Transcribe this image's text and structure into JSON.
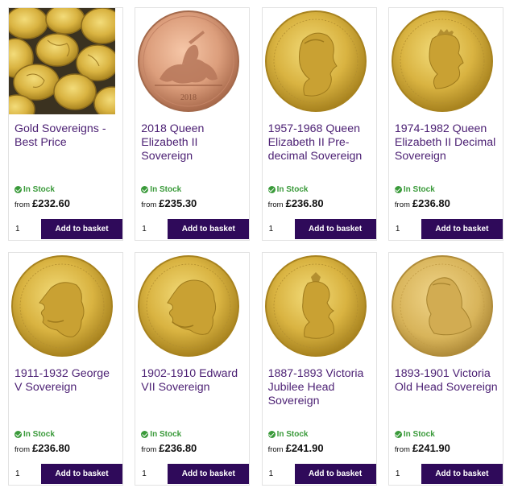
{
  "products": [
    {
      "title": "Gold Sovereigns - Best Price",
      "image_icon": "sovereign-pile-image",
      "stock": "In Stock",
      "from_label": "from",
      "price": "£232.60",
      "qty": "1",
      "button": "Add to basket"
    },
    {
      "title": "2018 Queen Elizabeth II Sovereign",
      "image_icon": "sovereign-2018-reverse-image",
      "coin_year": "2018",
      "stock": "In Stock",
      "from_label": "from",
      "price": "£235.30",
      "qty": "1",
      "button": "Add to basket"
    },
    {
      "title": "1957-1968 Queen Elizabeth II Pre-decimal Sovereign",
      "image_icon": "sovereign-elizabeth-young-image",
      "stock": "In Stock",
      "from_label": "from",
      "price": "£236.80",
      "qty": "1",
      "button": "Add to basket"
    },
    {
      "title": "1974-1982 Queen Elizabeth II Decimal Sovereign",
      "image_icon": "sovereign-elizabeth-decimal-image",
      "stock": "In Stock",
      "from_label": "from",
      "price": "£236.80",
      "qty": "1",
      "button": "Add to basket"
    },
    {
      "title": "1911-1932 George V Sovereign",
      "image_icon": "sovereign-george-v-image",
      "stock": "In Stock",
      "from_label": "from",
      "price": "£236.80",
      "qty": "1",
      "button": "Add to basket"
    },
    {
      "title": "1902-1910 Edward VII Sovereign",
      "image_icon": "sovereign-edward-vii-image",
      "stock": "In Stock",
      "from_label": "from",
      "price": "£236.80",
      "qty": "1",
      "button": "Add to basket"
    },
    {
      "title": "1887-1893 Victoria Jubilee Head Sovereign",
      "image_icon": "sovereign-victoria-jubilee-image",
      "stock": "In Stock",
      "from_label": "from",
      "price": "£241.90",
      "qty": "1",
      "button": "Add to basket"
    },
    {
      "title": "1893-1901 Victoria Old Head Sovereign",
      "image_icon": "sovereign-victoria-old-head-image",
      "stock": "In Stock",
      "from_label": "from",
      "price": "£241.90",
      "qty": "1",
      "button": "Add to basket"
    }
  ],
  "colors": {
    "title": "#4b1f73",
    "button_bg": "#2f0a5a",
    "stock_green": "#3a9a3a",
    "gold": "#d9b341",
    "rose_gold": "#d99a7a"
  }
}
